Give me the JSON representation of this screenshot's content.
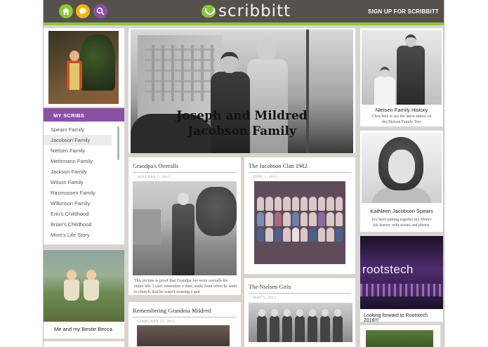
{
  "header": {
    "brand": "scribbitt",
    "signup_label": "SIGN UP FOR SCRIBBITT",
    "buttons": [
      {
        "icon": "home-icon",
        "color": "#8cc63f"
      },
      {
        "icon": "chat-icon",
        "color": "#f2b705"
      },
      {
        "icon": "search-icon",
        "color": "#8a4fa7"
      }
    ]
  },
  "sidebar": {
    "heading": "MY SCRIBS",
    "items": [
      {
        "label": "Spears Family"
      },
      {
        "label": "Jacobson Family"
      },
      {
        "label": "Nielsen Family"
      },
      {
        "label": "Mehrmann Family"
      },
      {
        "label": "Jackson Family"
      },
      {
        "label": "Wilson Family"
      },
      {
        "label": "Rasmussen Family"
      },
      {
        "label": "Wilkinson Family"
      },
      {
        "label": "Erin's Childhood"
      },
      {
        "label": "Brian's Childhood"
      },
      {
        "label": "Mom's Life Story"
      }
    ],
    "active_index": 1,
    "bottom_caption": "Me and my Bestie Becca"
  },
  "hero": {
    "title_line1": "Joseph and Mildred",
    "title_line2": "Jacobson Family"
  },
  "cards": {
    "overalls": {
      "title": "Grandpa's Overalls",
      "date": "JANUARY 5, 2015",
      "text": "This picture is proof that Grandpa Joe wore overalls his entire life. I can't remember a time, aside from when he went to church, that he wasn't wearing a pair"
    },
    "clan": {
      "title": "The Jacobson Clan 1982",
      "date": "JUNE 1, 2015"
    },
    "nielsen_girls": {
      "title": "The Nielsen Girls",
      "date": "MAY 5, 2015"
    },
    "grandma": {
      "title": "Remembering Grandma Mildred",
      "date": "FEBRUARY 23, 2015"
    }
  },
  "right": {
    "nielsen_history": {
      "title": "Nielsen Family History",
      "sub_line1": "Click here to see the latest entries on",
      "sub_line2": "the Nielsen Family Tree"
    },
    "kathleen": {
      "title": "Kathleen Jacobson Spears",
      "sub_line1": "I've been putting together my Mom's",
      "sub_line2": "life history with stories and photos."
    },
    "rootstech": {
      "logo": "rootstech",
      "caption": "Looking forward to Rootstech 2016!!!"
    }
  },
  "colors": {
    "header_bg": "#56514d",
    "accent_green": "#8cc63f",
    "accent_purple": "#8a4fa7",
    "page_bg": "#d8d5d0"
  }
}
